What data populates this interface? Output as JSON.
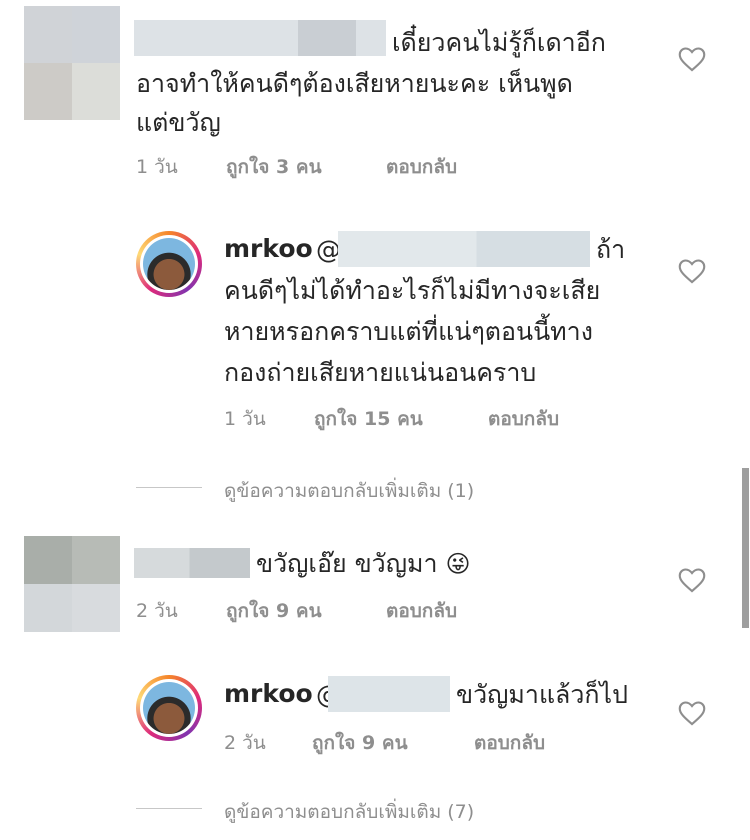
{
  "comments": [
    {
      "text_lines": [
        "เดี๋ยวคนไม่รู้ก็เดาอีก",
        "อาจทำให้คนดีๆต้องเสียหายนะคะ เห็นพูด",
        "แต่ขวัญ"
      ],
      "time": "1 วัน",
      "likes": "ถูกใจ 3 คน",
      "reply_label": "ตอบกลับ"
    },
    {
      "username": "mrkoo",
      "mention": "@",
      "text_lines": [
        "ถ้า",
        "คนดีๆไม่ได้ทำอะไรก็ไม่มีทางจะเสีย",
        "หายหรอกคราบแต่ที่แน่ๆตอนนี้ทาง",
        "กองถ่ายเสียหายแน่นอนคราบ"
      ],
      "time": "1 วัน",
      "likes": "ถูกใจ 15 คน",
      "reply_label": "ตอบกลับ"
    },
    {
      "text": "ขวัญเอ๊ย ขวัญมา",
      "emoji": "😜",
      "time": "2 วัน",
      "likes": "ถูกใจ 9 คน",
      "reply_label": "ตอบกลับ"
    },
    {
      "username": "mrkoo",
      "mention": "@",
      "text": "ขวัญมาแล้วก็ไป",
      "time": "2 วัน",
      "likes": "ถูกใจ 9 คน",
      "reply_label": "ตอบกลับ"
    }
  ],
  "view_more": [
    "ดูข้อความตอบกลับเพิ่มเติม (1)",
    "ดูข้อความตอบกลับเพิ่มเติม (7)"
  ],
  "icons": {
    "like": "heart-outline-icon"
  },
  "colors": {
    "meta_gray": "#8e8e8e",
    "text": "#262626"
  }
}
